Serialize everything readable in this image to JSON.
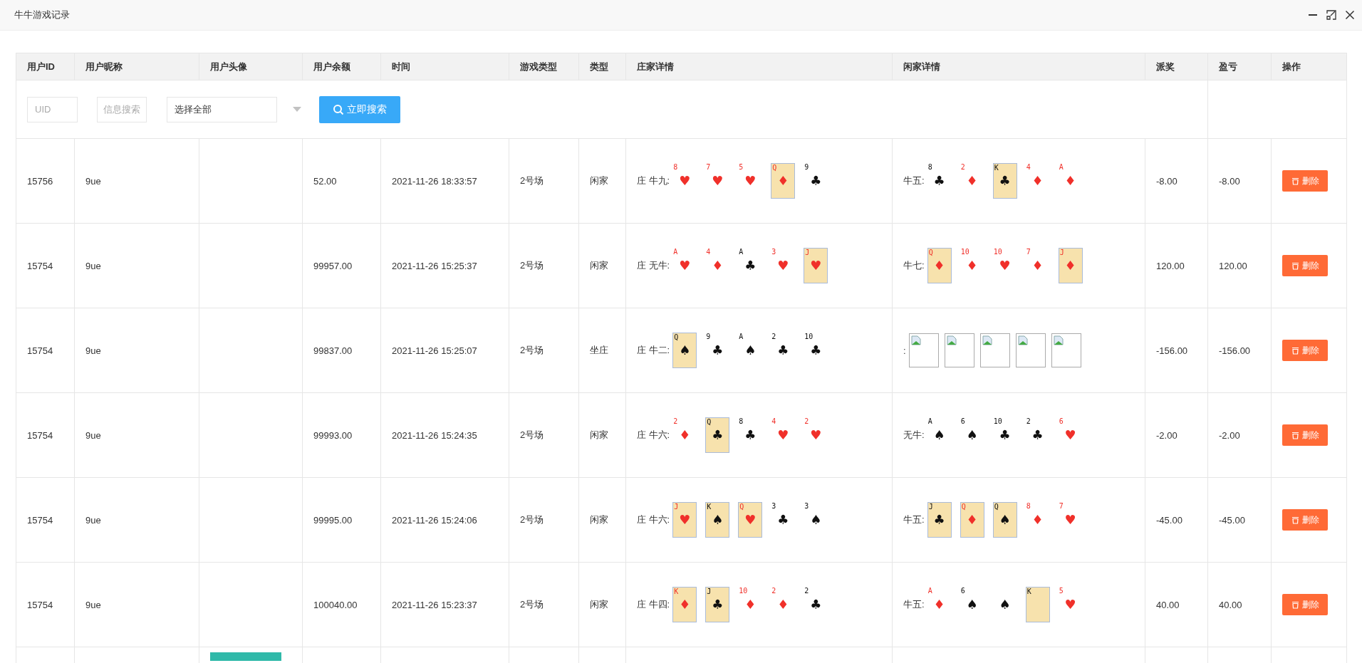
{
  "window": {
    "title": "牛牛游戏记录"
  },
  "table": {
    "columns": [
      "用户ID",
      "用户昵称",
      "用户头像",
      "用户余额",
      "时间",
      "游戏类型",
      "类型",
      "庄家详情",
      "闲家详情",
      "派奖",
      "盈亏",
      "操作"
    ],
    "filters": {
      "uid_placeholder": "UID",
      "info_placeholder": "信息搜索",
      "select_value": "选择全部",
      "search_button": "立即搜索"
    },
    "rows": [
      {
        "user_id": "15756",
        "nickname": "9ue",
        "balance": "52.00",
        "time": "2021-11-26 18:33:57",
        "game_type": "2号场",
        "role": "闲家",
        "banker": {
          "label": "庄 牛九:",
          "cards": [
            {
              "kind": "card",
              "rank": "8",
              "suit": "♥",
              "color": "#f0302a",
              "face": false
            },
            {
              "kind": "card",
              "rank": "7",
              "suit": "♥",
              "color": "#f0302a",
              "face": false
            },
            {
              "kind": "card",
              "rank": "5",
              "suit": "♥",
              "color": "#f0302a",
              "face": false
            },
            {
              "kind": "card",
              "rank": "Q",
              "suit": "♦",
              "color": "#f0302a",
              "face": true
            },
            {
              "kind": "card",
              "rank": "9",
              "suit": "♣",
              "color": "#111111",
              "face": false
            }
          ]
        },
        "player": {
          "label": "牛五:",
          "cards": [
            {
              "kind": "card",
              "rank": "8",
              "suit": "♣",
              "color": "#111111",
              "face": false
            },
            {
              "kind": "card",
              "rank": "2",
              "suit": "♦",
              "color": "#f0302a",
              "face": false
            },
            {
              "kind": "card",
              "rank": "K",
              "suit": "♣",
              "color": "#111111",
              "face": true
            },
            {
              "kind": "card",
              "rank": "4",
              "suit": "♦",
              "color": "#f0302a",
              "face": false
            },
            {
              "kind": "card",
              "rank": "A",
              "suit": "♦",
              "color": "#f0302a",
              "face": false
            }
          ]
        },
        "payout": "-8.00",
        "profit": "-8.00",
        "action": "删除"
      },
      {
        "user_id": "15754",
        "nickname": "9ue",
        "balance": "99957.00",
        "time": "2021-11-26 15:25:37",
        "game_type": "2号场",
        "role": "闲家",
        "banker": {
          "label": "庄 无牛:",
          "cards": [
            {
              "kind": "card",
              "rank": "A",
              "suit": "♥",
              "color": "#f0302a",
              "face": false
            },
            {
              "kind": "card",
              "rank": "4",
              "suit": "♦",
              "color": "#f0302a",
              "face": false
            },
            {
              "kind": "card",
              "rank": "A",
              "suit": "♣",
              "color": "#111111",
              "face": false
            },
            {
              "kind": "card",
              "rank": "3",
              "suit": "♥",
              "color": "#f0302a",
              "face": false
            },
            {
              "kind": "card",
              "rank": "J",
              "suit": "♥",
              "color": "#f0302a",
              "face": true
            }
          ]
        },
        "player": {
          "label": "牛七:",
          "cards": [
            {
              "kind": "card",
              "rank": "Q",
              "suit": "♦",
              "color": "#f0302a",
              "face": true
            },
            {
              "kind": "card",
              "rank": "10",
              "suit": "♦",
              "color": "#f0302a",
              "face": false
            },
            {
              "kind": "card",
              "rank": "10",
              "suit": "♥",
              "color": "#f0302a",
              "face": false
            },
            {
              "kind": "card",
              "rank": "7",
              "suit": "♦",
              "color": "#f0302a",
              "face": false
            },
            {
              "kind": "card",
              "rank": "J",
              "suit": "♦",
              "color": "#f0302a",
              "face": true
            }
          ]
        },
        "payout": "120.00",
        "profit": "120.00",
        "action": "删除"
      },
      {
        "user_id": "15754",
        "nickname": "9ue",
        "balance": "99837.00",
        "time": "2021-11-26 15:25:07",
        "game_type": "2号场",
        "role": "坐庄",
        "banker": {
          "label": "庄 牛二:",
          "cards": [
            {
              "kind": "card",
              "rank": "Q",
              "suit": "♠",
              "color": "#111111",
              "face": true
            },
            {
              "kind": "card",
              "rank": "9",
              "suit": "♣",
              "color": "#111111",
              "face": false
            },
            {
              "kind": "card",
              "rank": "A",
              "suit": "♠",
              "color": "#111111",
              "face": false
            },
            {
              "kind": "card",
              "rank": "2",
              "suit": "♣",
              "color": "#111111",
              "face": false
            },
            {
              "kind": "card",
              "rank": "10",
              "suit": "♣",
              "color": "#111111",
              "face": false
            }
          ]
        },
        "player": {
          "label": ":",
          "cards": [
            {
              "kind": "broken"
            },
            {
              "kind": "broken"
            },
            {
              "kind": "broken"
            },
            {
              "kind": "broken"
            },
            {
              "kind": "broken"
            }
          ]
        },
        "payout": "-156.00",
        "profit": "-156.00",
        "action": "删除"
      },
      {
        "user_id": "15754",
        "nickname": "9ue",
        "balance": "99993.00",
        "time": "2021-11-26 15:24:35",
        "game_type": "2号场",
        "role": "闲家",
        "banker": {
          "label": "庄 牛六:",
          "cards": [
            {
              "kind": "card",
              "rank": "2",
              "suit": "♦",
              "color": "#f0302a",
              "face": false
            },
            {
              "kind": "card",
              "rank": "Q",
              "suit": "♣",
              "color": "#111111",
              "face": true
            },
            {
              "kind": "card",
              "rank": "8",
              "suit": "♣",
              "color": "#111111",
              "face": false
            },
            {
              "kind": "card",
              "rank": "4",
              "suit": "♥",
              "color": "#f0302a",
              "face": false
            },
            {
              "kind": "card",
              "rank": "2",
              "suit": "♥",
              "color": "#f0302a",
              "face": false
            }
          ]
        },
        "player": {
          "label": "无牛:",
          "cards": [
            {
              "kind": "card",
              "rank": "A",
              "suit": "♠",
              "color": "#111111",
              "face": false
            },
            {
              "kind": "card",
              "rank": "6",
              "suit": "♠",
              "color": "#111111",
              "face": false
            },
            {
              "kind": "card",
              "rank": "10",
              "suit": "♣",
              "color": "#111111",
              "face": false
            },
            {
              "kind": "card",
              "rank": "2",
              "suit": "♣",
              "color": "#111111",
              "face": false
            },
            {
              "kind": "card",
              "rank": "6",
              "suit": "♥",
              "color": "#f0302a",
              "face": false
            }
          ]
        },
        "payout": "-2.00",
        "profit": "-2.00",
        "action": "删除"
      },
      {
        "user_id": "15754",
        "nickname": "9ue",
        "balance": "99995.00",
        "time": "2021-11-26 15:24:06",
        "game_type": "2号场",
        "role": "闲家",
        "banker": {
          "label": "庄 牛六:",
          "cards": [
            {
              "kind": "card",
              "rank": "J",
              "suit": "♥",
              "color": "#f0302a",
              "face": true
            },
            {
              "kind": "card",
              "rank": "K",
              "suit": "♠",
              "color": "#111111",
              "face": true
            },
            {
              "kind": "card",
              "rank": "Q",
              "suit": "♥",
              "color": "#f0302a",
              "face": true
            },
            {
              "kind": "card",
              "rank": "3",
              "suit": "♣",
              "color": "#111111",
              "face": false
            },
            {
              "kind": "card",
              "rank": "3",
              "suit": "♠",
              "color": "#111111",
              "face": false
            }
          ]
        },
        "player": {
          "label": "牛五:",
          "cards": [
            {
              "kind": "card",
              "rank": "J",
              "suit": "♣",
              "color": "#111111",
              "face": true
            },
            {
              "kind": "card",
              "rank": "Q",
              "suit": "♦",
              "color": "#f0302a",
              "face": true
            },
            {
              "kind": "card",
              "rank": "Q",
              "suit": "♠",
              "color": "#111111",
              "face": true
            },
            {
              "kind": "card",
              "rank": "8",
              "suit": "♦",
              "color": "#f0302a",
              "face": false
            },
            {
              "kind": "card",
              "rank": "7",
              "suit": "♥",
              "color": "#f0302a",
              "face": false
            }
          ]
        },
        "payout": "-45.00",
        "profit": "-45.00",
        "action": "删除"
      },
      {
        "user_id": "15754",
        "nickname": "9ue",
        "balance": "100040.00",
        "time": "2021-11-26 15:23:37",
        "game_type": "2号场",
        "role": "闲家",
        "banker": {
          "label": "庄 牛四:",
          "cards": [
            {
              "kind": "card",
              "rank": "K",
              "suit": "♦",
              "color": "#f0302a",
              "face": true
            },
            {
              "kind": "card",
              "rank": "J",
              "suit": "♣",
              "color": "#111111",
              "face": true
            },
            {
              "kind": "card",
              "rank": "10",
              "suit": "♦",
              "color": "#f0302a",
              "face": false
            },
            {
              "kind": "card",
              "rank": "2",
              "suit": "♦",
              "color": "#f0302a",
              "face": false
            },
            {
              "kind": "card",
              "rank": "2",
              "suit": "♣",
              "color": "#111111",
              "face": false
            }
          ]
        },
        "player": {
          "label": "牛五:",
          "cards": [
            {
              "kind": "card",
              "rank": "A",
              "suit": "♦",
              "color": "#f0302a",
              "face": false
            },
            {
              "kind": "card",
              "rank": "6",
              "suit": "♠",
              "color": "#111111",
              "face": false
            },
            {
              "kind": "card",
              "suit": "♠",
              "color": "#111111",
              "face": false
            },
            {
              "kind": "card",
              "rank": "K",
              "face": true
            },
            {
              "kind": "card",
              "rank": "5",
              "suit": "♥",
              "color": "#f0302a",
              "face": false
            }
          ]
        },
        "payout": "40.00",
        "profit": "40.00",
        "action": "删除"
      }
    ],
    "next_row_avatar": true
  }
}
